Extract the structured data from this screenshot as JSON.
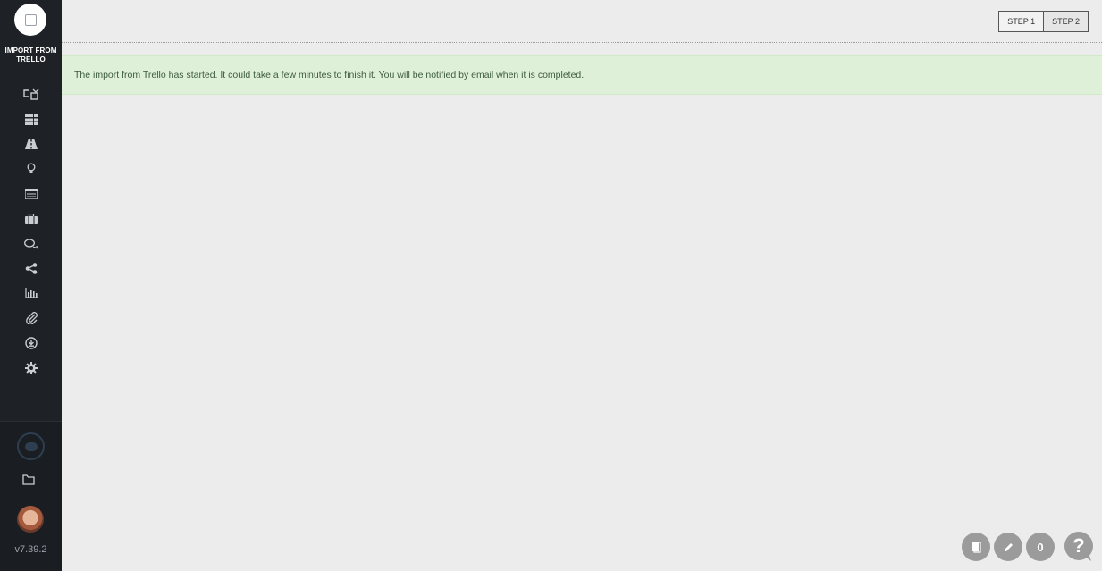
{
  "sidebar": {
    "title": "IMPORT FROM TRELLO",
    "nav_icons": [
      "switch-icon",
      "grid-icon",
      "road-icon",
      "lightbulb-icon",
      "list-icon",
      "briefcase-icon",
      "chat-icon",
      "share-icon",
      "bar-chart-icon",
      "paperclip-icon",
      "download-circle-icon",
      "gear-icon"
    ],
    "bottom": {
      "version": "v7.39.2"
    }
  },
  "topbar": {
    "steps": [
      "STEP 1",
      "STEP 2"
    ],
    "active_step": "STEP 2"
  },
  "alert": {
    "message": "The import from Trello has started. It could take a few minutes to finish it. You will be notified by email when it is completed.",
    "color": "#dff0d8"
  },
  "floating": {
    "count": "0",
    "help": "?"
  },
  "colors": {
    "sidebar_bg": "#1e2226",
    "page_bg": "#ececec",
    "button_grey": "#9b9b9b"
  }
}
